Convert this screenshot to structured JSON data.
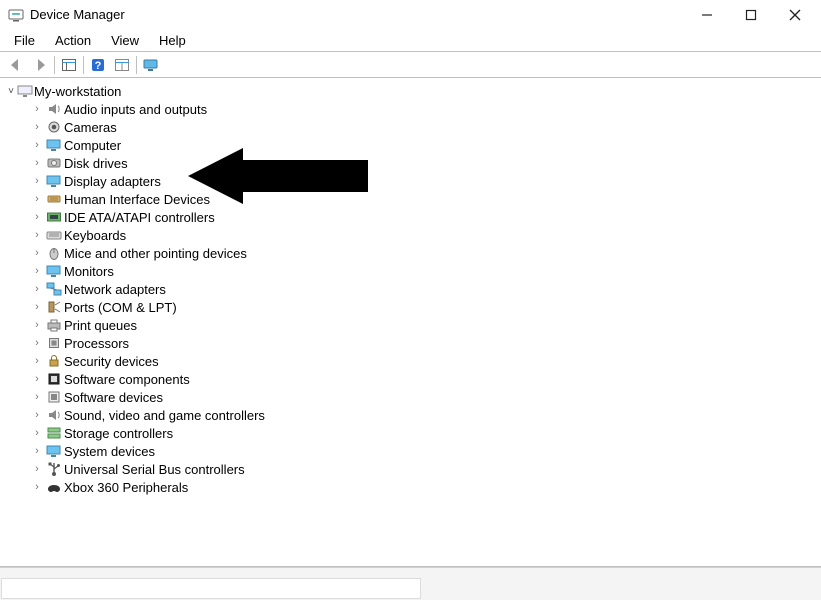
{
  "window": {
    "title": "Device Manager"
  },
  "menu": {
    "file": "File",
    "action": "Action",
    "view": "View",
    "help": "Help"
  },
  "tree": {
    "root": {
      "label": "My-workstation"
    },
    "items": [
      {
        "label": "Audio inputs and outputs",
        "icon": "audio-icon"
      },
      {
        "label": "Cameras",
        "icon": "camera-icon"
      },
      {
        "label": "Computer",
        "icon": "computer-icon"
      },
      {
        "label": "Disk drives",
        "icon": "disk-icon"
      },
      {
        "label": "Display adapters",
        "icon": "display-icon"
      },
      {
        "label": "Human Interface Devices",
        "icon": "hid-icon"
      },
      {
        "label": "IDE ATA/ATAPI controllers",
        "icon": "ide-icon"
      },
      {
        "label": "Keyboards",
        "icon": "keyboard-icon"
      },
      {
        "label": "Mice and other pointing devices",
        "icon": "mouse-icon"
      },
      {
        "label": "Monitors",
        "icon": "monitor-icon"
      },
      {
        "label": "Network adapters",
        "icon": "network-icon"
      },
      {
        "label": "Ports (COM & LPT)",
        "icon": "ports-icon"
      },
      {
        "label": "Print queues",
        "icon": "printer-icon"
      },
      {
        "label": "Processors",
        "icon": "cpu-icon"
      },
      {
        "label": "Security devices",
        "icon": "security-icon"
      },
      {
        "label": "Software components",
        "icon": "sw-comp-icon"
      },
      {
        "label": "Software devices",
        "icon": "sw-dev-icon"
      },
      {
        "label": "Sound, video and game controllers",
        "icon": "sound-icon"
      },
      {
        "label": "Storage controllers",
        "icon": "storage-icon"
      },
      {
        "label": "System devices",
        "icon": "system-icon"
      },
      {
        "label": "Universal Serial Bus controllers",
        "icon": "usb-icon"
      },
      {
        "label": "Xbox 360 Peripherals",
        "icon": "xbox-icon"
      }
    ]
  }
}
